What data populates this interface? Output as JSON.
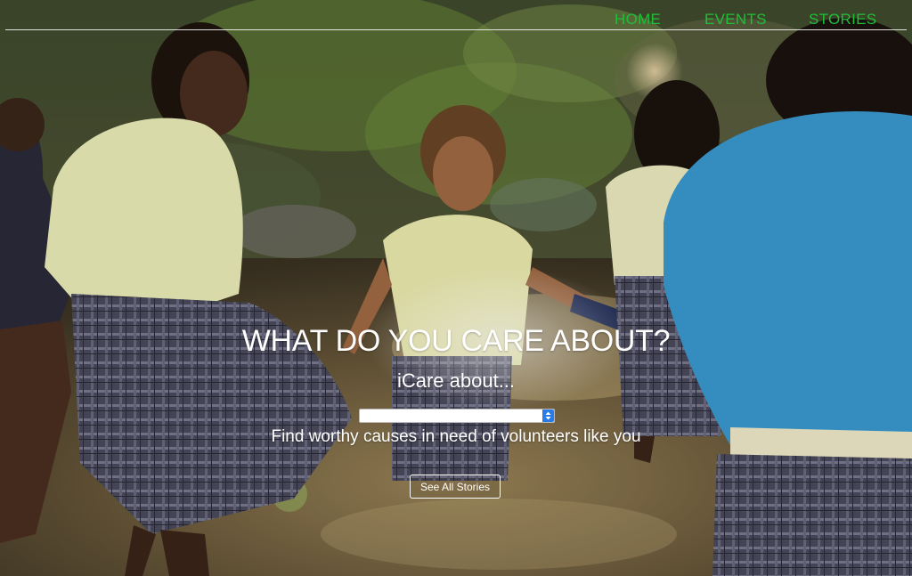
{
  "nav": {
    "items": [
      {
        "label": "HOME"
      },
      {
        "label": "EVENTS"
      },
      {
        "label": "STORIES"
      }
    ],
    "link_color": "#1fbf3a"
  },
  "hero": {
    "headline": "WHAT DO YOU CARE ABOUT?",
    "subhead": "iCare about...",
    "cause_select": {
      "selected": ""
    },
    "tagline": "Find worthy causes in need of volunteers like you",
    "cta_label": "See All Stories"
  },
  "colors": {
    "accent_nav": "#1fbf3a",
    "select_arrow": "#2b7be6",
    "text": "#ffffff"
  }
}
